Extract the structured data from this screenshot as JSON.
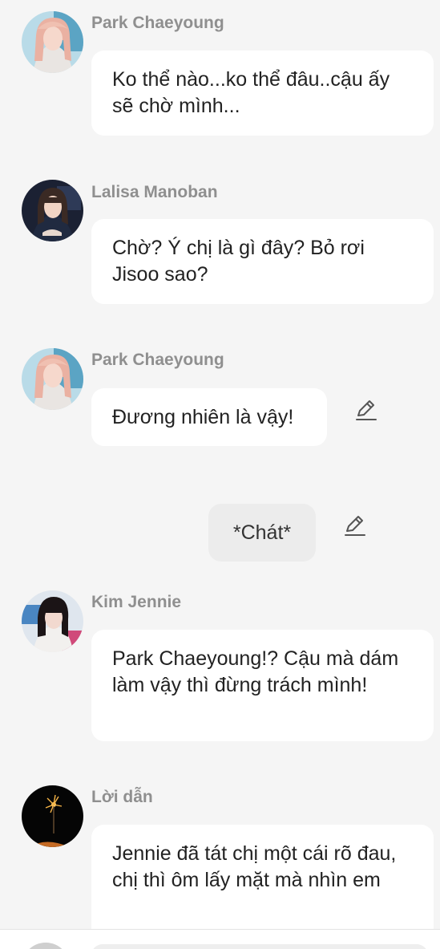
{
  "colors": {
    "background": "#f5f5f5",
    "bubble": "#ffffff",
    "action_bubble": "#ececec",
    "name": "#8f8f8f",
    "text": "#222222"
  },
  "messages": [
    {
      "sender": "Park Chaeyoung",
      "avatar": "avatar-park-chaeyoung",
      "text": "Ko thể nào...ko thể đâu..cậu ấy sẽ chờ mình..."
    },
    {
      "sender": "Lalisa Manoban",
      "avatar": "avatar-lalisa-manoban",
      "text": "Chờ? Ý chị là gì đây? Bỏ rơi Jisoo sao?"
    },
    {
      "sender": "Park Chaeyoung",
      "avatar": "avatar-park-chaeyoung",
      "text": "Đương nhiên là vậy!",
      "editable": true
    },
    {
      "action_text": "*Chát*",
      "editable": true
    },
    {
      "sender": "Kim Jennie",
      "avatar": "avatar-kim-jennie",
      "text": "Park Chaeyoung!? Cậu mà dám làm vậy thì đừng trách mình!"
    },
    {
      "sender": "Lời dẫn",
      "avatar": "avatar-narrator",
      "text": "Jennie đã tát chị một cái rõ đau, chị thì ôm lấy mặt mà nhìn em"
    }
  ],
  "icons": {
    "edit": "pencil-edit-icon"
  }
}
